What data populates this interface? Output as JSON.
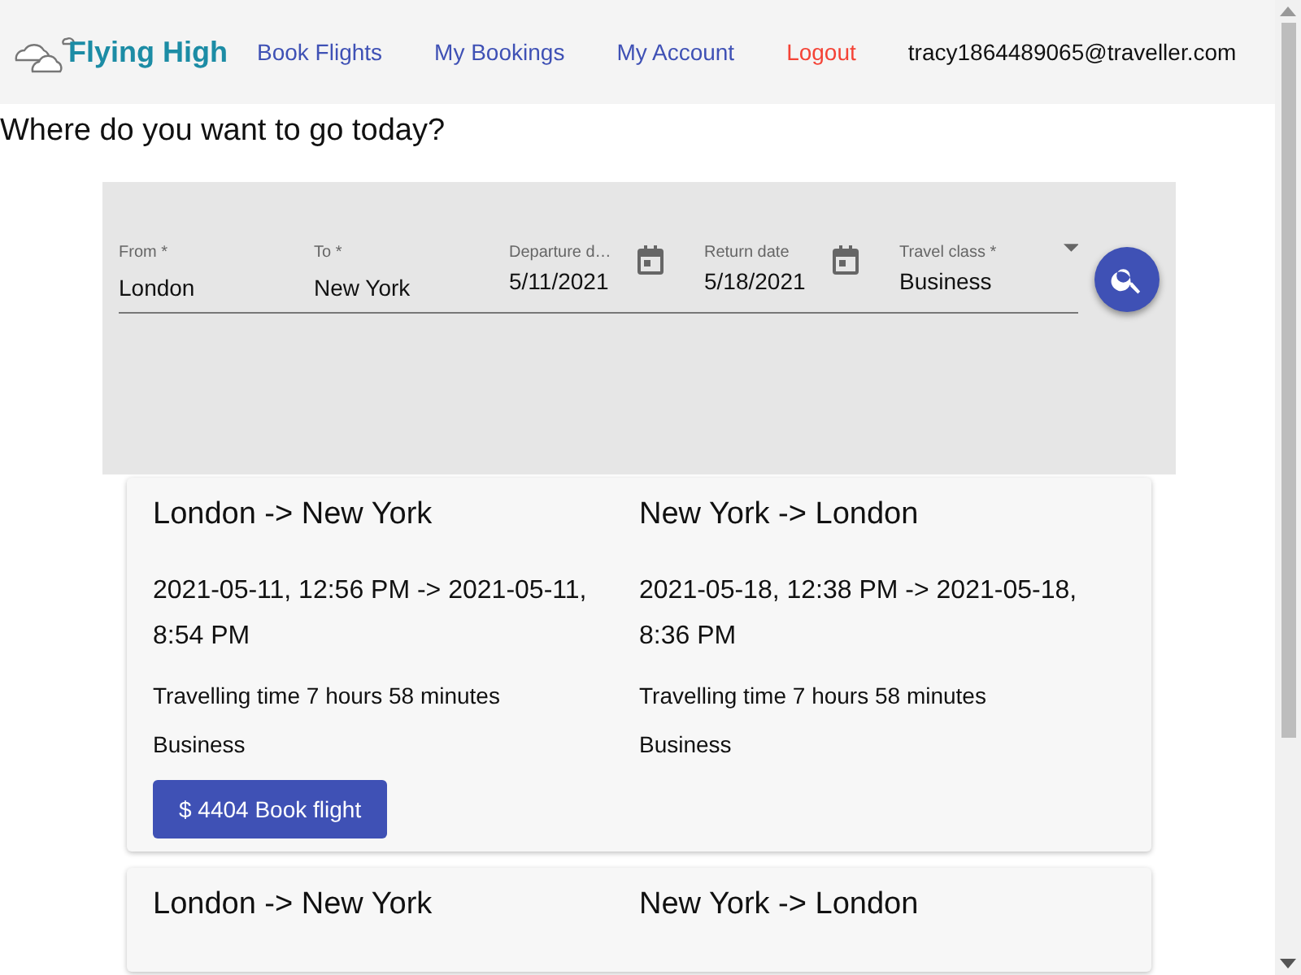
{
  "header": {
    "logo": "Flying High",
    "nav": [
      {
        "label": "Book Flights",
        "kind": "link"
      },
      {
        "label": "My Bookings",
        "kind": "link"
      },
      {
        "label": "My Account",
        "kind": "link"
      },
      {
        "label": "Logout",
        "kind": "logout"
      }
    ],
    "user": "tracy1864489065@traveller.com"
  },
  "heading": "Where do you want to go today?",
  "search": {
    "fields": [
      {
        "label": "From *",
        "value": "London",
        "kind": "text"
      },
      {
        "label": "To *",
        "value": "New York",
        "kind": "text"
      },
      {
        "label": "Departure d…",
        "value": "5/11/2021",
        "kind": "date"
      },
      {
        "label": "Return date",
        "value": "5/18/2021",
        "kind": "date"
      },
      {
        "label": "Travel class *",
        "value": "Business",
        "kind": "select"
      }
    ]
  },
  "results": [
    {
      "legs": [
        {
          "route": "London -> New York",
          "times": "2021-05-11, 12:56 PM -> 2021-05-11, 8:54 PM",
          "duration": "Travelling time 7 hours 58 minutes",
          "class": "Business"
        },
        {
          "route": "New York -> London",
          "times": "2021-05-18, 12:38 PM -> 2021-05-18, 8:36 PM",
          "duration": "Travelling time 7 hours 58 minutes",
          "class": "Business"
        }
      ],
      "button": "$ 4404 Book flight"
    },
    {
      "legs": [
        {
          "route": "London -> New York"
        },
        {
          "route": "New York -> London"
        }
      ]
    }
  ]
}
